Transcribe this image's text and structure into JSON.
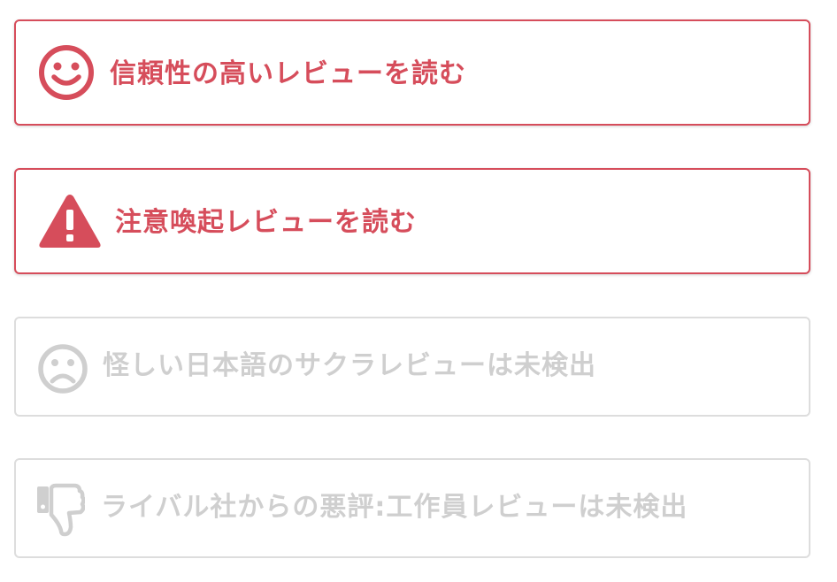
{
  "colors": {
    "accent": "#d64d5b",
    "muted_border": "#dddddd",
    "muted_text": "#cfcfcf"
  },
  "cards": [
    {
      "label": "信頼性の高いレビューを読む",
      "icon": "smile-icon",
      "state": "active"
    },
    {
      "label": "注意喚起レビューを読む",
      "icon": "warning-icon",
      "state": "active"
    },
    {
      "label": "怪しい日本語のサクラレビューは未検出",
      "icon": "frown-icon",
      "state": "inactive"
    },
    {
      "label": "ライバル社からの悪評:工作員レビューは未検出",
      "icon": "thumbs-down-icon",
      "state": "inactive"
    }
  ]
}
